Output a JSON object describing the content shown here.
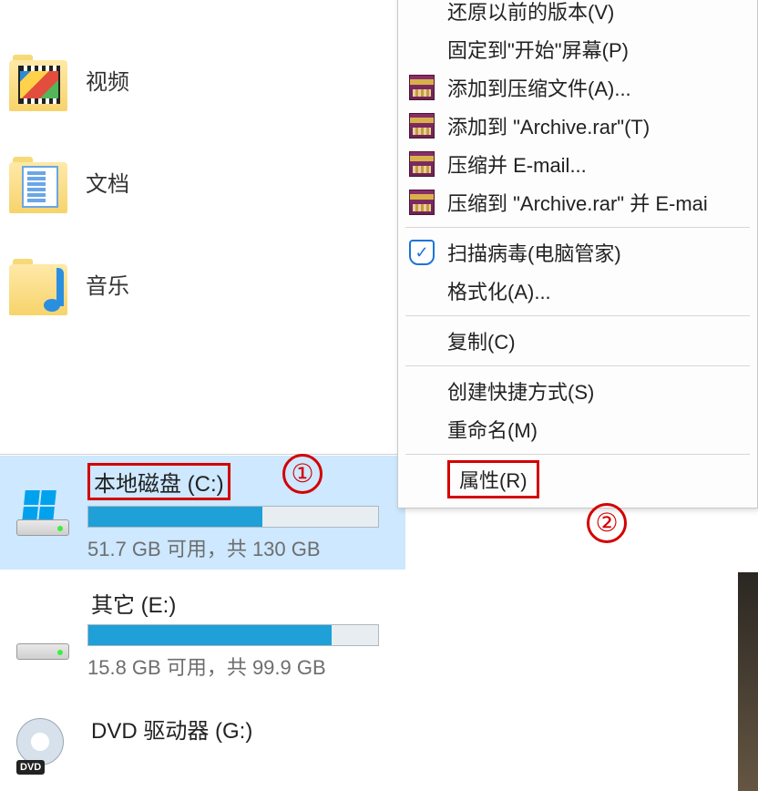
{
  "libraries": {
    "video": "视频",
    "documents": "文档",
    "music": "音乐"
  },
  "drives": {
    "c": {
      "label": "本地磁盘 (C:)",
      "free_text": "51.7 GB 可用，共 130 GB",
      "fill_percent": 60
    },
    "e": {
      "label": "其它 (E:)",
      "free_text": "15.8 GB 可用，共 99.9 GB",
      "fill_percent": 84
    },
    "g": {
      "label": "DVD 驱动器 (G:)"
    }
  },
  "context_menu": {
    "item_cut_top": "",
    "restore_prev": "还原以前的版本(V)",
    "pin_start": "固定到\"开始\"屏幕(P)",
    "add_archive": "添加到压缩文件(A)...",
    "add_archive_named": "添加到 \"Archive.rar\"(T)",
    "compress_email": "压缩并 E-mail...",
    "compress_named_email": "压缩到 \"Archive.rar\" 并 E-mai",
    "scan_virus": "扫描病毒(电脑管家)",
    "format": "格式化(A)...",
    "copy": "复制(C)",
    "create_shortcut": "创建快捷方式(S)",
    "rename": "重命名(M)",
    "properties": "属性(R)"
  },
  "annotations": {
    "one": "①",
    "two": "②"
  },
  "dvd_badge": "DVD"
}
